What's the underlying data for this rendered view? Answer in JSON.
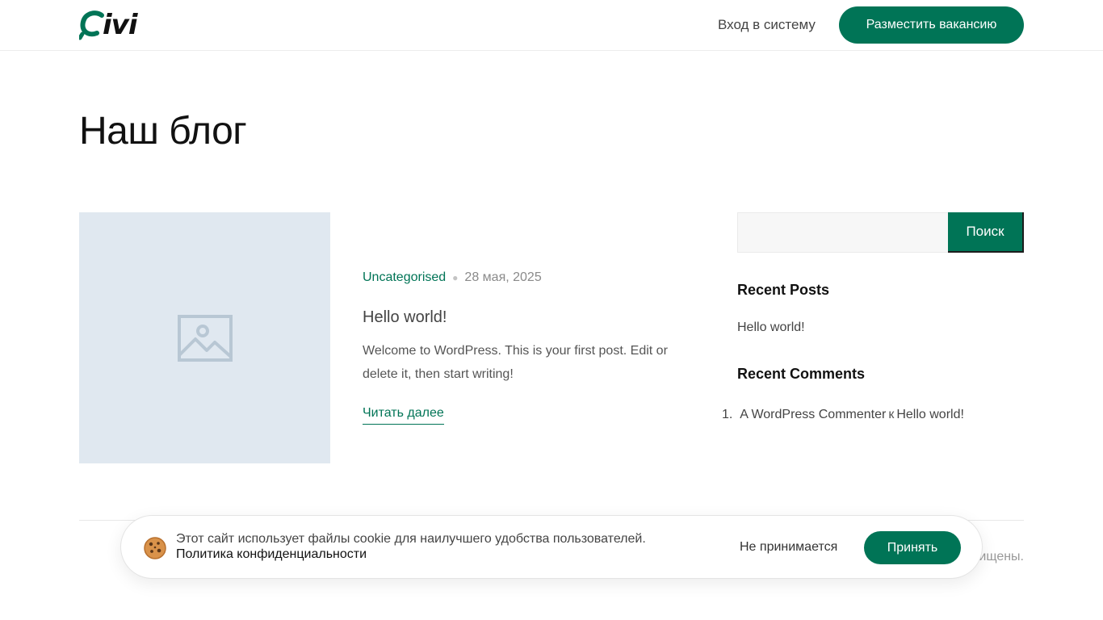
{
  "header": {
    "logo_text": "ivi",
    "login_label": "Вход в систему",
    "post_job_label": "Разместить вакансию"
  },
  "page": {
    "title": "Наш блог"
  },
  "post": {
    "thumbnail_icon": "image-placeholder-icon",
    "category": "Uncategorised",
    "date": "28 мая, 2025",
    "title": "Hello world!",
    "excerpt": "Welcome to WordPress. This is your first post. Edit or delete it, then start writing!",
    "read_more_label": "Читать далее"
  },
  "sidebar": {
    "search_placeholder": "",
    "search_button_label": "Поиск",
    "recent_posts_title": "Recent Posts",
    "recent_posts": [
      "Hello world!"
    ],
    "recent_comments_title": "Recent Comments",
    "recent_comments": [
      {
        "author": "A WordPress Commenter",
        "connector": "к",
        "post": "Hello world!"
      }
    ]
  },
  "footer": {
    "copyright_visible": "ищены."
  },
  "cookie": {
    "icon": "cookie-icon",
    "message": "Этот сайт использует файлы cookie для наилучшего удобства пользователей.",
    "policy_label": "Политика конфиденциальности",
    "decline_label": "Не принимается",
    "accept_label": "Принять"
  },
  "colors": {
    "brand": "#007456",
    "placeholder_bg": "#e0e8f0",
    "placeholder_icon": "#b8c7d4"
  }
}
